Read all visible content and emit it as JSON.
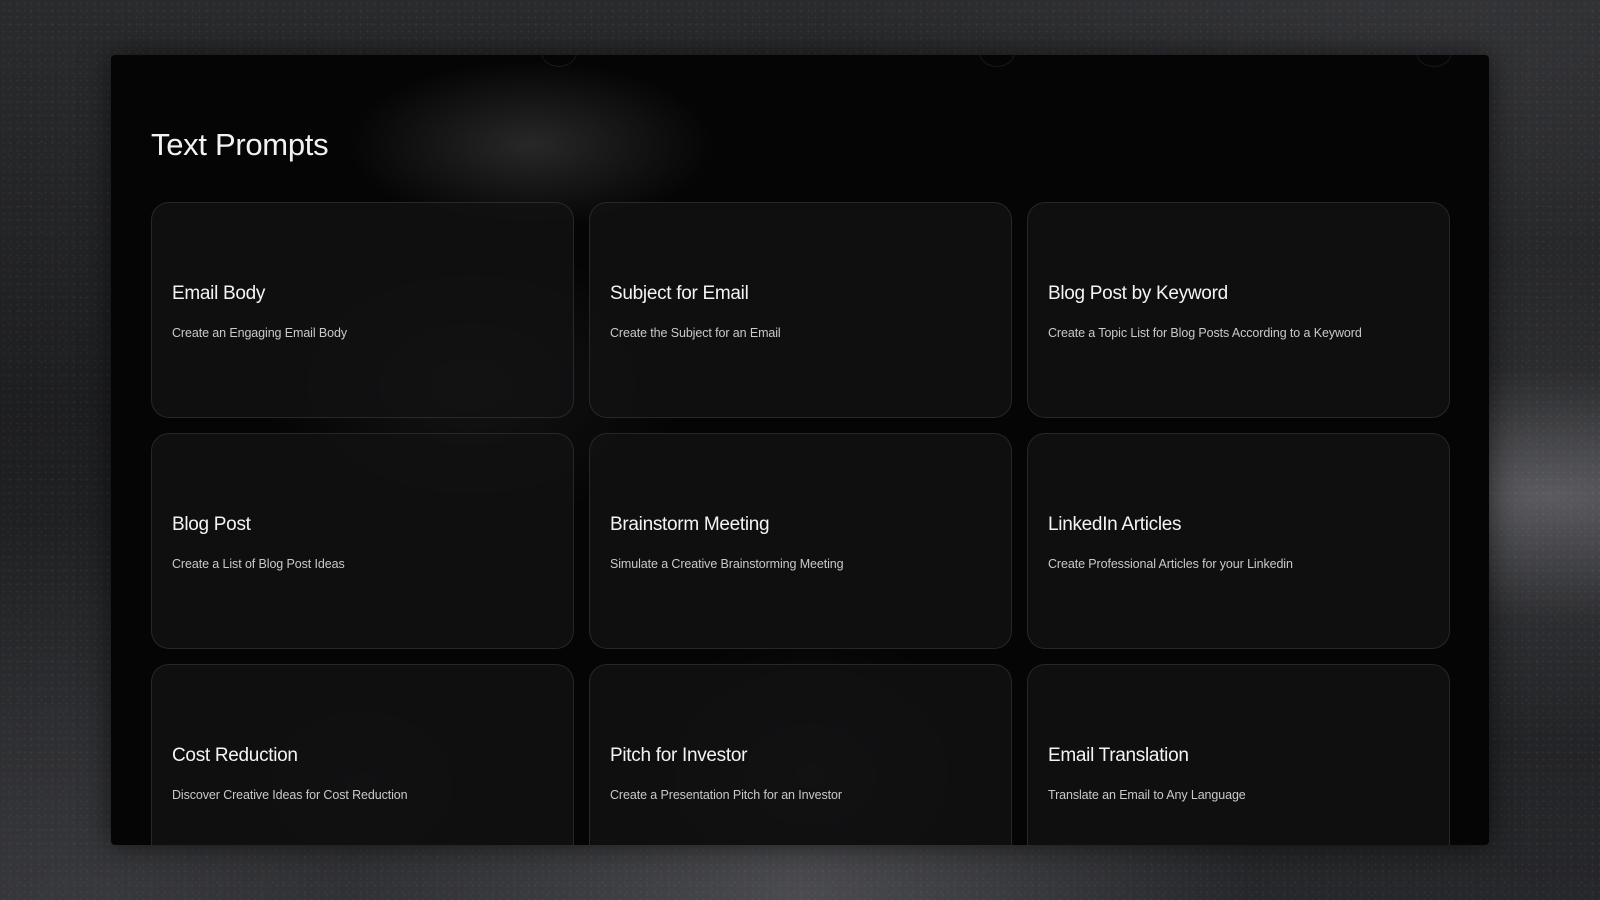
{
  "page": {
    "title": "Text Prompts"
  },
  "prompts": [
    {
      "title": "Email Body",
      "description": "Create an Engaging Email Body"
    },
    {
      "title": "Subject for Email",
      "description": "Create the Subject for an Email"
    },
    {
      "title": "Blog Post by Keyword",
      "description": "Create a Topic List for Blog Posts According to a Keyword"
    },
    {
      "title": "Blog Post",
      "description": "Create a List of Blog Post Ideas"
    },
    {
      "title": "Brainstorm Meeting",
      "description": "Simulate a Creative Brainstorming Meeting"
    },
    {
      "title": "LinkedIn Articles",
      "description": "Create Professional Articles for your Linkedin"
    },
    {
      "title": "Cost Reduction",
      "description": "Discover Creative Ideas for Cost Reduction"
    },
    {
      "title": "Pitch for Investor",
      "description": "Create a Presentation Pitch for an Investor"
    },
    {
      "title": "Email Translation",
      "description": "Translate an Email to Any Language"
    }
  ]
}
